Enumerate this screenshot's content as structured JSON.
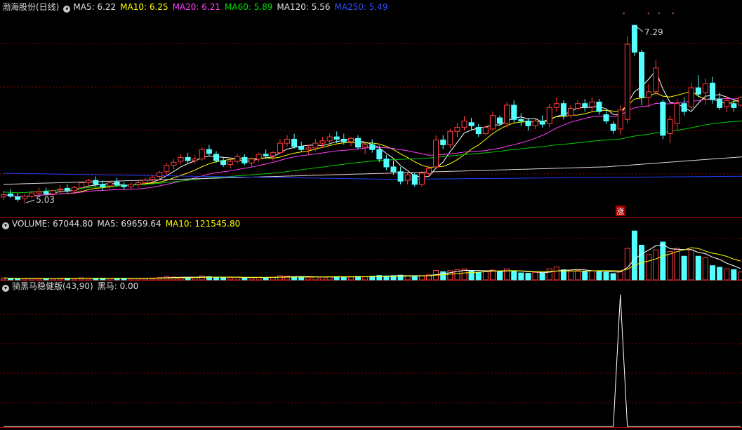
{
  "colors": {
    "up": "#ff3b3b",
    "down": "#54ffff",
    "grid": "#8b0000",
    "separator": "#b00000",
    "ma5": "#ffffff",
    "ma10": "#ffff00",
    "ma20": "#ff40ff",
    "ma60": "#00d000",
    "ma120": "#d8d8d8",
    "ma250": "#2040ff"
  },
  "price_panel": {
    "title": "渤海股份(日线)",
    "ma_legend": [
      {
        "label": "MA5: 6.22",
        "color": "#e0e0e0"
      },
      {
        "label": "MA10: 6.25",
        "color": "#ffff00"
      },
      {
        "label": "MA20: 6.21",
        "color": "#ff40ff"
      },
      {
        "label": "MA60: 5.89",
        "color": "#00e000"
      },
      {
        "label": "MA120: 5.56",
        "color": "#e0e0e0"
      },
      {
        "label": "MA250: 5.49",
        "color": "#3050ff"
      }
    ],
    "high_label": "7.29",
    "low_label": "5.03",
    "signal_badge": "涨"
  },
  "volume_panel": {
    "legend": [
      {
        "label": "VOLUME: 67044.80",
        "color": "#e0e0e0"
      },
      {
        "label": "MA5: 69659.64",
        "color": "#e0e0e0"
      },
      {
        "label": "MA10: 121545.80",
        "color": "#ffff00"
      }
    ]
  },
  "indicator_panel": {
    "name": "骑黑马稳健版(43,90)",
    "legend": [
      {
        "label": "黑马: 0.00",
        "color": "#e0e0e0"
      }
    ]
  },
  "chart_data": [
    {
      "type": "candlestick",
      "ohlc": [
        [
          5.12,
          5.2,
          5.08,
          5.15
        ],
        [
          5.16,
          5.22,
          5.11,
          5.13
        ],
        [
          5.12,
          5.17,
          5.06,
          5.09
        ],
        [
          5.1,
          5.16,
          5.03,
          5.13
        ],
        [
          5.13,
          5.2,
          5.1,
          5.17
        ],
        [
          5.17,
          5.24,
          5.13,
          5.19
        ],
        [
          5.19,
          5.24,
          5.14,
          5.16
        ],
        [
          5.16,
          5.21,
          5.12,
          5.2
        ],
        [
          5.21,
          5.27,
          5.17,
          5.22
        ],
        [
          5.23,
          5.28,
          5.17,
          5.2
        ],
        [
          5.2,
          5.26,
          5.15,
          5.24
        ],
        [
          5.24,
          5.32,
          5.2,
          5.3
        ],
        [
          5.3,
          5.35,
          5.26,
          5.33
        ],
        [
          5.33,
          5.38,
          5.25,
          5.28
        ],
        [
          5.28,
          5.33,
          5.2,
          5.25
        ],
        [
          5.26,
          5.32,
          5.22,
          5.3
        ],
        [
          5.31,
          5.36,
          5.25,
          5.27
        ],
        [
          5.27,
          5.31,
          5.21,
          5.25
        ],
        [
          5.25,
          5.31,
          5.21,
          5.28
        ],
        [
          5.28,
          5.33,
          5.24,
          5.3
        ],
        [
          5.3,
          5.36,
          5.26,
          5.33
        ],
        [
          5.34,
          5.4,
          5.3,
          5.37
        ],
        [
          5.38,
          5.45,
          5.34,
          5.43
        ],
        [
          5.44,
          5.55,
          5.4,
          5.52
        ],
        [
          5.52,
          5.6,
          5.47,
          5.56
        ],
        [
          5.57,
          5.66,
          5.53,
          5.62
        ],
        [
          5.62,
          5.68,
          5.55,
          5.58
        ],
        [
          5.58,
          5.65,
          5.54,
          5.6
        ],
        [
          5.6,
          5.75,
          5.58,
          5.72
        ],
        [
          5.72,
          5.78,
          5.64,
          5.67
        ],
        [
          5.66,
          5.7,
          5.55,
          5.58
        ],
        [
          5.58,
          5.63,
          5.5,
          5.53
        ],
        [
          5.53,
          5.6,
          5.48,
          5.57
        ],
        [
          5.57,
          5.66,
          5.55,
          5.63
        ],
        [
          5.62,
          5.66,
          5.52,
          5.55
        ],
        [
          5.55,
          5.62,
          5.5,
          5.6
        ],
        [
          5.6,
          5.68,
          5.56,
          5.66
        ],
        [
          5.66,
          5.72,
          5.6,
          5.64
        ],
        [
          5.64,
          5.7,
          5.58,
          5.68
        ],
        [
          5.68,
          5.85,
          5.66,
          5.8
        ],
        [
          5.8,
          5.9,
          5.76,
          5.85
        ],
        [
          5.85,
          5.92,
          5.73,
          5.76
        ],
        [
          5.76,
          5.82,
          5.69,
          5.72
        ],
        [
          5.72,
          5.78,
          5.66,
          5.74
        ],
        [
          5.74,
          5.85,
          5.7,
          5.8
        ],
        [
          5.8,
          5.88,
          5.74,
          5.83
        ],
        [
          5.83,
          5.92,
          5.78,
          5.88
        ],
        [
          5.88,
          5.95,
          5.8,
          5.85
        ],
        [
          5.85,
          5.92,
          5.78,
          5.82
        ],
        [
          5.82,
          5.88,
          5.76,
          5.86
        ],
        [
          5.86,
          5.9,
          5.72,
          5.75
        ],
        [
          5.75,
          5.82,
          5.66,
          5.78
        ],
        [
          5.78,
          5.85,
          5.68,
          5.72
        ],
        [
          5.72,
          5.77,
          5.56,
          5.6
        ],
        [
          5.6,
          5.65,
          5.46,
          5.5
        ],
        [
          5.5,
          5.58,
          5.4,
          5.44
        ],
        [
          5.44,
          5.5,
          5.28,
          5.32
        ],
        [
          5.33,
          5.44,
          5.28,
          5.4
        ],
        [
          5.4,
          5.42,
          5.25,
          5.28
        ],
        [
          5.28,
          5.45,
          5.25,
          5.42
        ],
        [
          5.42,
          5.52,
          5.38,
          5.48
        ],
        [
          5.5,
          5.9,
          5.48,
          5.84
        ],
        [
          5.84,
          5.9,
          5.72,
          5.78
        ],
        [
          5.78,
          5.98,
          5.74,
          5.95
        ],
        [
          5.95,
          6.05,
          5.88,
          6.0
        ],
        [
          6.0,
          6.14,
          5.96,
          6.08
        ],
        [
          6.06,
          6.12,
          5.96,
          6.02
        ],
        [
          6.0,
          6.04,
          5.88,
          5.92
        ],
        [
          5.92,
          6.02,
          5.9,
          6.0
        ],
        [
          5.98,
          6.2,
          5.96,
          6.15
        ],
        [
          6.12,
          6.15,
          6.02,
          6.05
        ],
        [
          6.05,
          6.32,
          6.0,
          6.28
        ],
        [
          6.28,
          6.34,
          6.06,
          6.1
        ],
        [
          6.1,
          6.18,
          6.02,
          6.08
        ],
        [
          6.08,
          6.12,
          5.96,
          6.02
        ],
        [
          6.02,
          6.12,
          5.98,
          6.08
        ],
        [
          6.08,
          6.15,
          6.0,
          6.04
        ],
        [
          6.05,
          6.3,
          6.0,
          6.25
        ],
        [
          6.25,
          6.38,
          6.2,
          6.3
        ],
        [
          6.3,
          6.34,
          6.1,
          6.15
        ],
        [
          6.15,
          6.28,
          6.12,
          6.24
        ],
        [
          6.24,
          6.35,
          6.22,
          6.3
        ],
        [
          6.3,
          6.36,
          6.2,
          6.26
        ],
        [
          6.26,
          6.38,
          6.2,
          6.32
        ],
        [
          6.32,
          6.36,
          6.16,
          6.2
        ],
        [
          6.16,
          6.22,
          6.04,
          6.08
        ],
        [
          6.04,
          6.08,
          5.92,
          5.96
        ],
        [
          5.98,
          6.28,
          5.9,
          6.22
        ],
        [
          6.1,
          7.15,
          6.05,
          7.05
        ],
        [
          7.29,
          7.29,
          6.9,
          6.95
        ],
        [
          6.95,
          6.98,
          6.28,
          6.38
        ],
        [
          6.38,
          6.55,
          6.25,
          6.45
        ],
        [
          6.45,
          6.85,
          6.4,
          6.75
        ],
        [
          6.32,
          6.35,
          5.85,
          5.9
        ],
        [
          5.92,
          6.15,
          5.8,
          6.1
        ],
        [
          6.05,
          6.36,
          5.96,
          6.3
        ],
        [
          6.3,
          6.38,
          6.15,
          6.2
        ],
        [
          6.26,
          6.56,
          6.22,
          6.5
        ],
        [
          6.5,
          6.66,
          6.38,
          6.42
        ],
        [
          6.44,
          6.62,
          6.28,
          6.55
        ],
        [
          6.56,
          6.64,
          6.3,
          6.35
        ],
        [
          6.36,
          6.44,
          6.22,
          6.25
        ],
        [
          6.26,
          6.4,
          6.2,
          6.34
        ],
        [
          6.3,
          6.36,
          6.2,
          6.25
        ],
        [
          6.28,
          6.4,
          6.26,
          6.38
        ],
        [
          6.38,
          6.46,
          6.24,
          6.28
        ]
      ],
      "ma_lines": [
        "MA5",
        "MA10",
        "MA20",
        "MA60",
        "MA120",
        "MA250"
      ],
      "high_marker": 7.29,
      "low_marker": 5.03
    },
    {
      "type": "bar",
      "volume": [
        120,
        90,
        80,
        95,
        110,
        100,
        85,
        90,
        105,
        110,
        95,
        130,
        120,
        100,
        90,
        110,
        95,
        85,
        90,
        100,
        110,
        120,
        150,
        220,
        180,
        160,
        140,
        150,
        250,
        200,
        160,
        140,
        150,
        170,
        150,
        140,
        160,
        150,
        170,
        260,
        240,
        200,
        180,
        170,
        190,
        180,
        200,
        210,
        190,
        180,
        220,
        210,
        230,
        280,
        250,
        270,
        300,
        240,
        260,
        250,
        320,
        600,
        520,
        580,
        640,
        700,
        560,
        480,
        520,
        620,
        500,
        700,
        540,
        440,
        420,
        460,
        420,
        700,
        820,
        640,
        560,
        600,
        540,
        580,
        520,
        480,
        400,
        520,
        2000,
        3100,
        2200,
        1600,
        1900,
        2400,
        1800,
        2000,
        1500,
        1900,
        1500,
        1400,
        900,
        800,
        700,
        650,
        500
      ]
    },
    {
      "type": "line",
      "series": [
        {
          "name": "黑马",
          "values": [
            0,
            0,
            0,
            0,
            0,
            0,
            0,
            0,
            0,
            0,
            0,
            0,
            0,
            0,
            0,
            0,
            0,
            0,
            0,
            0,
            0,
            0,
            0,
            0,
            0,
            0,
            0,
            0,
            0,
            0,
            0,
            0,
            0,
            0,
            0,
            0,
            0,
            0,
            0,
            0,
            0,
            0,
            0,
            0,
            0,
            0,
            0,
            0,
            0,
            0,
            0,
            0,
            0,
            0,
            0,
            0,
            0,
            0,
            0,
            0,
            0,
            0,
            0,
            0,
            0,
            0,
            0,
            0,
            0,
            0,
            0,
            0,
            0,
            0,
            0,
            0,
            0,
            0,
            0,
            0,
            0,
            0,
            0,
            0,
            0,
            0,
            0,
            1,
            0,
            0,
            0,
            0,
            0,
            0,
            0,
            0,
            0,
            0,
            0,
            0,
            0,
            0,
            0,
            0,
            0
          ]
        }
      ]
    }
  ]
}
